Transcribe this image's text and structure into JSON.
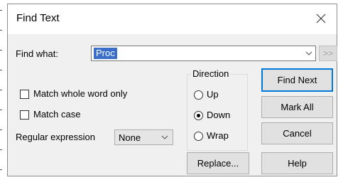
{
  "dialog": {
    "title": "Find Text",
    "find_what_label": "Find what:",
    "find_what_value": "Proc",
    "more_button_label": ">>",
    "options": {
      "match_whole_word": {
        "label": "Match whole word only",
        "checked": false
      },
      "match_case": {
        "label": "Match case",
        "checked": false
      }
    },
    "regex": {
      "label": "Regular expression",
      "selected": "None"
    },
    "direction": {
      "label": "Direction",
      "options": [
        "Up",
        "Down",
        "Wrap"
      ],
      "selected": "Down"
    },
    "buttons": {
      "find_next": "Find Next",
      "mark_all": "Mark All",
      "cancel": "Cancel",
      "replace": "Replace...",
      "help": "Help"
    }
  },
  "colors": {
    "dialog_bg": "#f0f0f0",
    "title_bg": "#ffffff",
    "selection_bg": "#3a6ec9",
    "default_button_border": "#0078d7"
  },
  "icons": {
    "close": "close-icon",
    "dropdown": "chevron-down-icon"
  }
}
